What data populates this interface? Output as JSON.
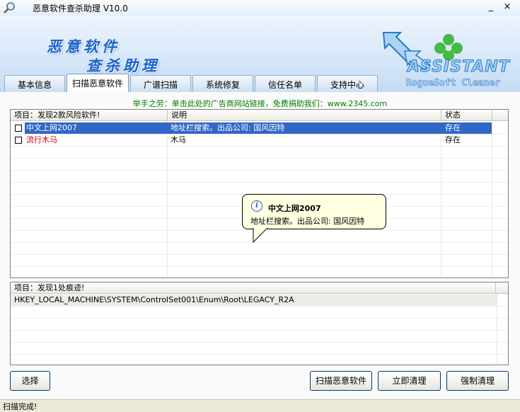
{
  "window": {
    "title": "恶意软件查杀助理 V10.0",
    "minimize_label": "_",
    "close_label": "×"
  },
  "banner": {
    "line1": "恶意软件",
    "line2": "查杀助理",
    "logo_main": "ASSISTANT",
    "logo_sub": "RogueSoft Cleaner"
  },
  "tabs": [
    {
      "label": "基本信息"
    },
    {
      "label": "扫描恶意软件"
    },
    {
      "label": "广谱扫描"
    },
    {
      "label": "系统修复"
    },
    {
      "label": "信任名单"
    },
    {
      "label": "支持中心"
    }
  ],
  "active_tab": 1,
  "promo": "举手之劳：单击此处的广告商网站链接，免费捐助我们：www.2345.com",
  "software_list": {
    "columns": [
      "项目：发现2款风险软件!",
      "说明",
      "状态"
    ],
    "rows": [
      {
        "name": "中文上网2007",
        "description": "地址栏搜索。出品公司: 国风因特",
        "status": "存在",
        "selected": true
      },
      {
        "name": "流行木马",
        "description": "木马",
        "status": "存在",
        "selected": false
      }
    ]
  },
  "tooltip": {
    "icon": "info-icon",
    "title": "中文上网2007",
    "text": "地址栏搜索。出品公司: 国风因特"
  },
  "traces_list": {
    "header": "项目：发现1处痕迹!",
    "rows": [
      {
        "path": "HKEY_LOCAL_MACHINE\\SYSTEM\\ControlSet001\\Enum\\Root\\LEGACY_R2A"
      }
    ]
  },
  "buttons": {
    "select": "选择",
    "scan": "扫描恶意软件",
    "clean_now": "立即清理",
    "force_clean": "强制清理"
  },
  "status": "扫描完成!",
  "colors": {
    "selection": "#3167c6",
    "trojan_text": "#cc0000",
    "promo_text": "#008000",
    "banner_text": "#1d63c9"
  }
}
